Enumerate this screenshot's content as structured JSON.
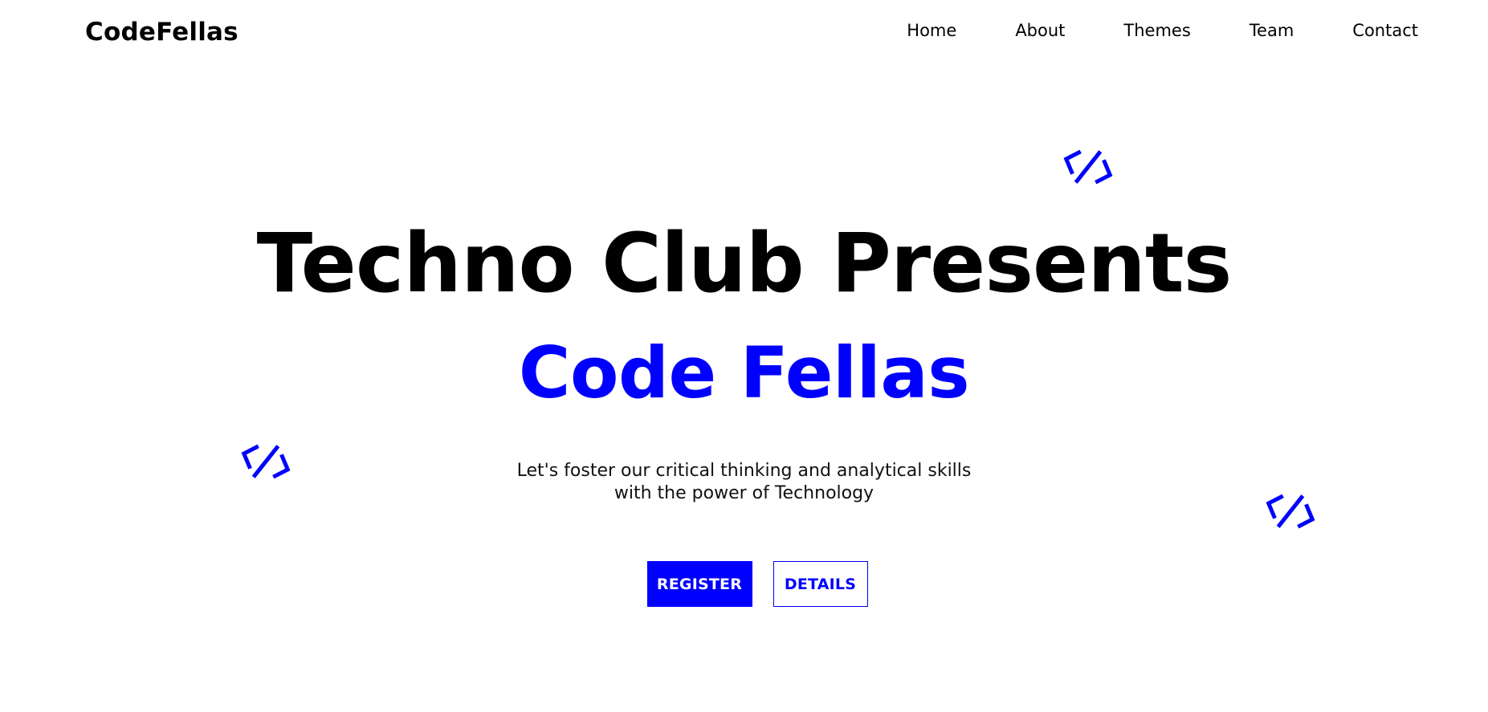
{
  "colors": {
    "accent": "#0000ff",
    "text": "#000000",
    "background": "#ffffff"
  },
  "header": {
    "brand": "CodeFellas",
    "nav": [
      {
        "label": "Home"
      },
      {
        "label": "About"
      },
      {
        "label": "Themes"
      },
      {
        "label": "Team"
      },
      {
        "label": "Contact"
      }
    ]
  },
  "hero": {
    "title": "Techno Club Presents",
    "subtitle": "Code Fellas",
    "tagline_line1": "Let's foster our critical thinking and analytical skills",
    "tagline_line2": "with the power of Technology",
    "buttons": {
      "register": "REGISTER",
      "details": "DETAILS"
    }
  },
  "decorations": {
    "icon": "code-brackets-icon"
  }
}
